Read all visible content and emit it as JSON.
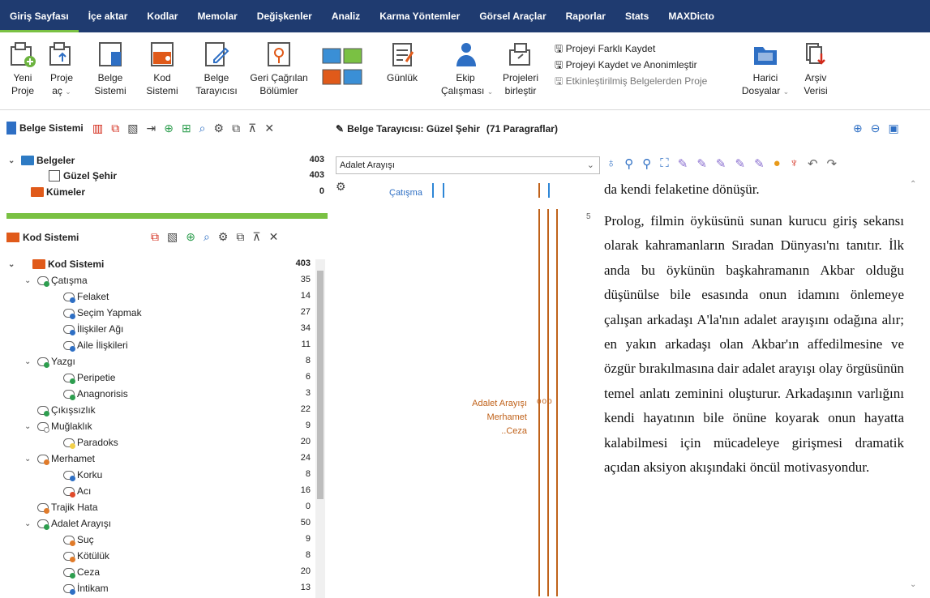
{
  "menu": {
    "items": [
      "Giriş Sayfası",
      "İçe aktar",
      "Kodlar",
      "Memolar",
      "Değişkenler",
      "Analiz",
      "Karma Yöntemler",
      "Görsel Araçlar",
      "Raporlar",
      "Stats",
      "MAXDicto"
    ]
  },
  "ribbon": {
    "yeni": [
      "Yeni",
      "Proje"
    ],
    "proje": [
      "Proje",
      "aç"
    ],
    "belge_sistemi": [
      "Belge",
      "Sistemi"
    ],
    "kod_sistemi": [
      "Kod",
      "Sistemi"
    ],
    "belge_tarayicisi": [
      "Belge",
      "Tarayıcısı"
    ],
    "geri": [
      "Geri Çağrılan",
      "Bölümler"
    ],
    "gunluk": "Günlük",
    "ekip": [
      "Ekip",
      "Çalışması"
    ],
    "projeleri": [
      "Projeleri",
      "birleştir"
    ],
    "save_list": [
      "Projeyi Farklı Kaydet",
      "Projeyi Kaydet ve Anonimleştir",
      "Etkinleştirilmiş Belgelerden Proje"
    ],
    "harici": [
      "Harici",
      "Dosyalar"
    ],
    "arsiv": [
      "Arşiv",
      "Verisi"
    ]
  },
  "doc_system": {
    "title": "Belge Sistemi",
    "rows": [
      {
        "label": "Belgeler",
        "count": "403"
      },
      {
        "label": "Güzel Şehir",
        "count": "403"
      },
      {
        "label": "Kümeler",
        "count": "0"
      }
    ]
  },
  "code_system": {
    "title": "Kod Sistemi",
    "rows": [
      {
        "label": "Kod Sistemi",
        "count": "403",
        "level": 0,
        "chev": true,
        "type": "root"
      },
      {
        "label": "Çatışma",
        "count": "35",
        "level": 1,
        "chev": true,
        "color": "#2e9e4f"
      },
      {
        "label": "Felaket",
        "count": "14",
        "level": 2,
        "color": "#2e6fc4"
      },
      {
        "label": "Seçim Yapmak",
        "count": "27",
        "level": 2,
        "color": "#2e6fc4"
      },
      {
        "label": "İlişkiler Ağı",
        "count": "34",
        "level": 2,
        "color": "#2e6fc4"
      },
      {
        "label": "Aile İlişkileri",
        "count": "11",
        "level": 2,
        "color": "#2e6fc4"
      },
      {
        "label": "Yazgı",
        "count": "8",
        "level": 1,
        "chev": true,
        "color": "#2e9e4f"
      },
      {
        "label": "Peripetie",
        "count": "6",
        "level": 2,
        "color": "#2e9e4f"
      },
      {
        "label": "Anagnorisis",
        "count": "3",
        "level": 2,
        "color": "#2e9e4f"
      },
      {
        "label": "Çıkışsızlık",
        "count": "22",
        "level": 1,
        "color": "#2e9e4f"
      },
      {
        "label": "Muğlaklık",
        "count": "9",
        "level": 1,
        "chev": true,
        "color": "#ffffff"
      },
      {
        "label": "Paradoks",
        "count": "20",
        "level": 2,
        "color": "#f2d04a"
      },
      {
        "label": "Merhamet",
        "count": "24",
        "level": 1,
        "chev": true,
        "color": "#e07b2a"
      },
      {
        "label": "Korku",
        "count": "8",
        "level": 2,
        "color": "#2e6fc4"
      },
      {
        "label": "Acı",
        "count": "16",
        "level": 2,
        "color": "#e04a2a"
      },
      {
        "label": "Trajik Hata",
        "count": "0",
        "level": 1,
        "color": "#e07b2a"
      },
      {
        "label": "Adalet Arayışı",
        "count": "50",
        "level": 1,
        "chev": true,
        "color": "#2e9e4f"
      },
      {
        "label": "Suç",
        "count": "9",
        "level": 2,
        "color": "#e07b2a"
      },
      {
        "label": "Kötülük",
        "count": "8",
        "level": 2,
        "color": "#e07b2a"
      },
      {
        "label": "Ceza",
        "count": "20",
        "level": 2,
        "color": "#2e9e4f"
      },
      {
        "label": "İntikam",
        "count": "13",
        "level": 2,
        "color": "#2e6fc4"
      }
    ]
  },
  "browser": {
    "title": "Belge Tarayıcısı: Güzel Şehir",
    "count": "(71 Paragraflar)",
    "dropdown": "Adalet Arayışı",
    "code_top": "Çatışma",
    "code_labels": [
      "Adalet Arayışı",
      "Merhamet",
      "..Ceza"
    ],
    "para_num": "5",
    "text_first": "da kendi felaketine dönüşür.",
    "text_body": "Prolog, filmin öyküsünü sunan kurucu giriş sekansı olarak kahramanların Sıradan Dünyası'nı tanıtır. İlk anda bu öykünün başkahramanın Akbar olduğu düşünülse bile esasında onun idamını önlemeye çalışan arkadaşı A'la'nın adalet arayışını odağına alır; en yakın arkadaşı olan Akbar'ın affedilmesine ve özgür bırakılmasına dair adalet arayışı olay örgüsünün temel anlatı zeminini oluşturur. Arkadaşının varlığını kendi hayatının bile önüne koyarak onun hayatta kalabilmesi için mücadeleye girişmesi dramatik açıdan aksiyon akışındaki öncül motivasyondur."
  },
  "colors": {
    "menubar": "#1f3b70",
    "accent": "#7ac143",
    "code_line": "#c0621a",
    "code_blue": "#2e86d6"
  }
}
